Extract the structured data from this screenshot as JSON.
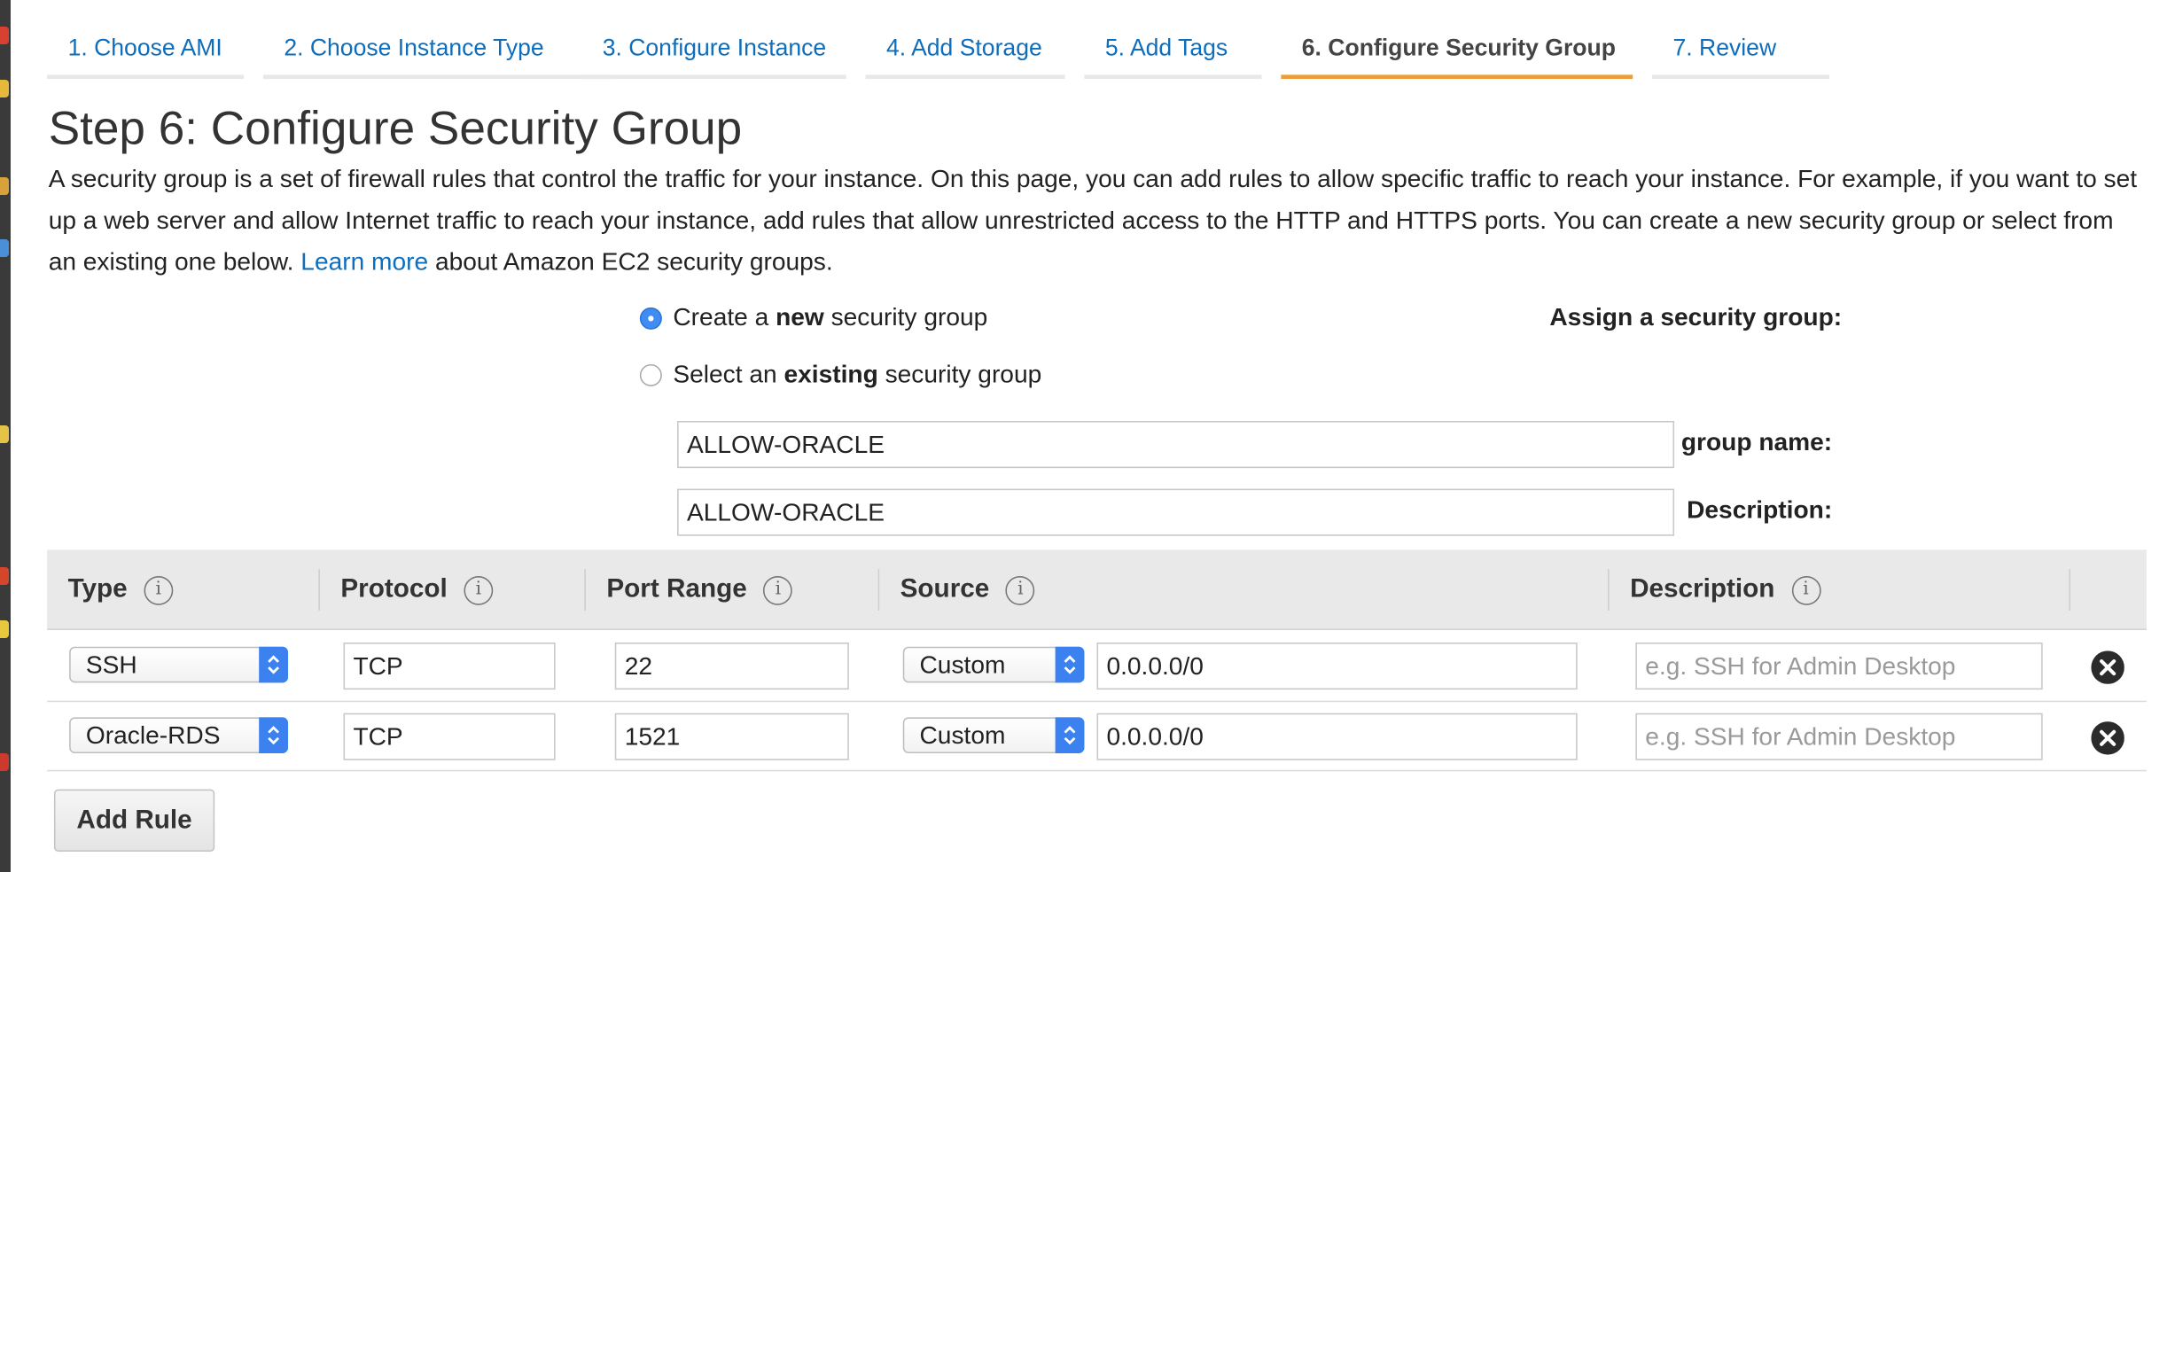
{
  "tabs": [
    {
      "label": "1. Choose AMI",
      "active": false
    },
    {
      "label": "2. Choose Instance Type",
      "active": false
    },
    {
      "label": "3. Configure Instance",
      "active": false
    },
    {
      "label": "4. Add Storage",
      "active": false
    },
    {
      "label": "5. Add Tags",
      "active": false
    },
    {
      "label": "6. Configure Security Group",
      "active": true
    },
    {
      "label": "7. Review",
      "active": false
    }
  ],
  "page_title": "Step 6: Configure Security Group",
  "intro": {
    "text_before": "A security group is a set of firewall rules that control the traffic for your instance. On this page, you can add rules to allow specific traffic to reach your instance. For example, if you want to set up a web server and allow Internet traffic to reach your instance, add rules that allow unrestricted access to the HTTP and HTTPS ports. You can create a new security group or select from an existing one below.",
    "link": "Learn more",
    "text_after": "about Amazon EC2 security groups."
  },
  "assign": {
    "label": "Assign a security group:",
    "option_new": {
      "pre": "Create a ",
      "bold": "new",
      "post": " security group",
      "selected": true
    },
    "option_existing": {
      "pre": "Select an ",
      "bold": "existing",
      "post": " security group",
      "selected": false
    }
  },
  "form": {
    "name_label": "Security group name:",
    "name_value": "ALLOW-ORACLE",
    "desc_label": "Description:",
    "desc_value": "ALLOW-ORACLE"
  },
  "table": {
    "headers": [
      "Type",
      "Protocol",
      "Port Range",
      "Source",
      "Description"
    ],
    "info_glyph": "i",
    "rows": [
      {
        "type": "SSH",
        "protocol": "TCP",
        "port": "22",
        "source_mode": "Custom",
        "source_cidr": "0.0.0.0/0",
        "description_placeholder": "e.g. SSH for Admin Desktop"
      },
      {
        "type": "Oracle-RDS",
        "protocol": "TCP",
        "port": "1521",
        "source_mode": "Custom",
        "source_cidr": "0.0.0.0/0",
        "description_placeholder": "e.g. SSH for Admin Desktop"
      }
    ]
  },
  "add_rule_label": "Add Rule",
  "colors": {
    "link": "#0d6ebd",
    "active_tab_underline": "#ec9d35",
    "select_accent": "#3b82f0"
  }
}
